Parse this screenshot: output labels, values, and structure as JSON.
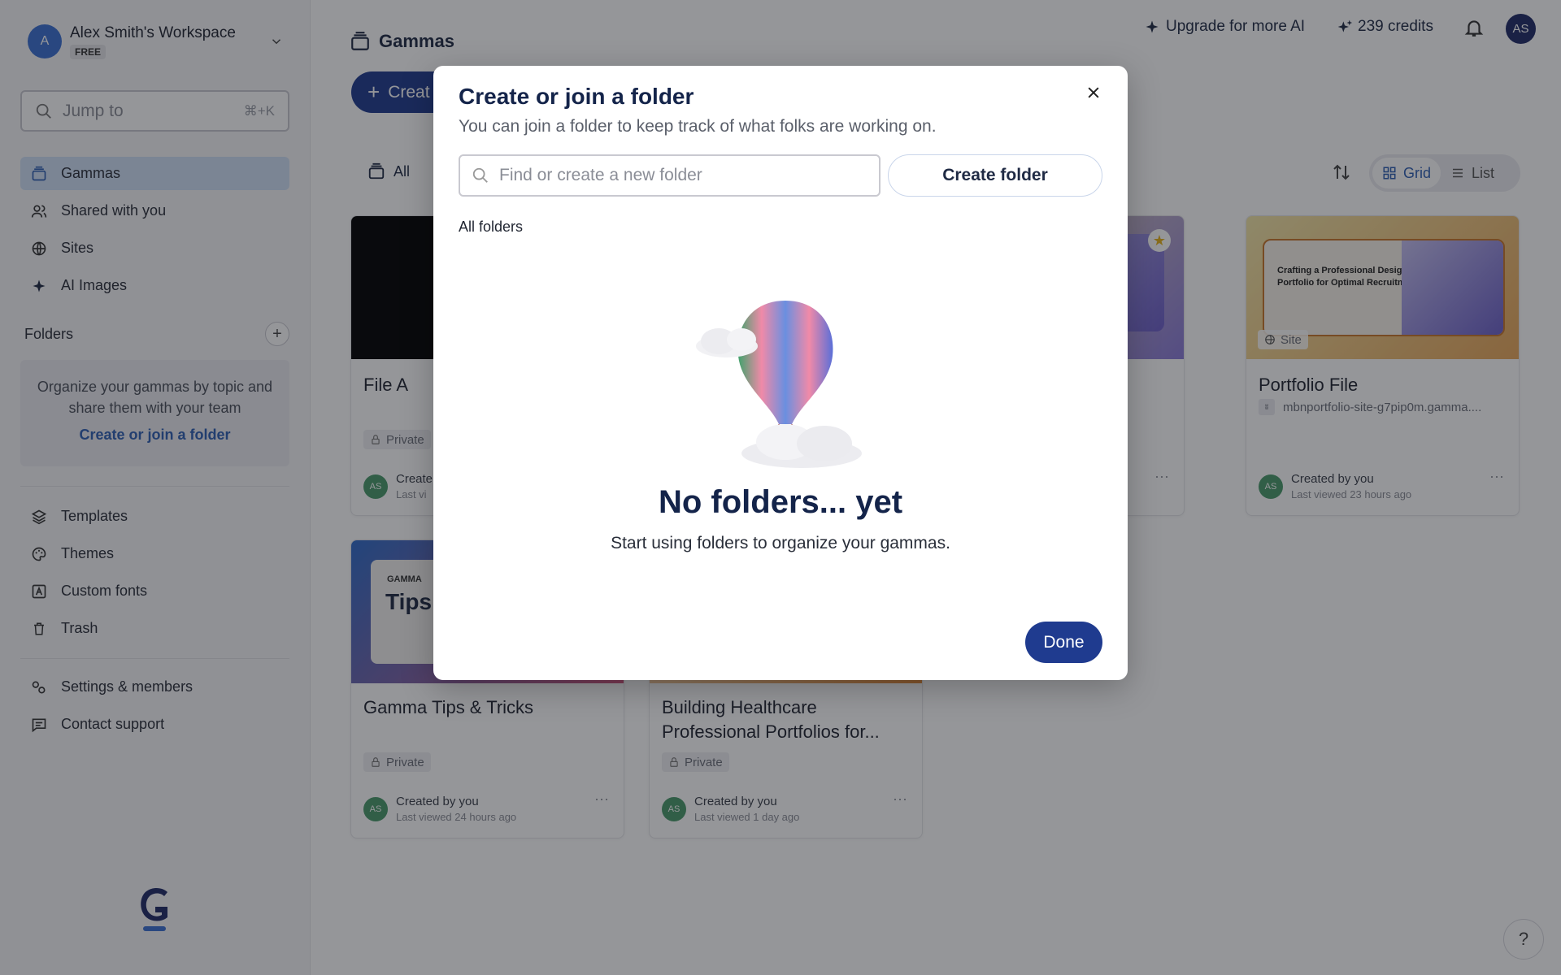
{
  "colors": {
    "accent": "#1f3b8f",
    "link": "#2f5fb3",
    "active_nav": "#cfe0f6",
    "overlay": "rgba(20,22,28,0.45)"
  },
  "workspace": {
    "avatar_letter": "A",
    "name": "Alex Smith's Workspace",
    "plan": "FREE"
  },
  "jump": {
    "placeholder": "Jump to",
    "shortcut": "⌘+K"
  },
  "nav": [
    {
      "label": "Gammas",
      "icon": "stack-icon",
      "active": true
    },
    {
      "label": "Shared with you",
      "icon": "users-icon"
    },
    {
      "label": "Sites",
      "icon": "globe-icon"
    },
    {
      "label": "AI Images",
      "icon": "sparkle-icon"
    }
  ],
  "folders": {
    "heading": "Folders",
    "empty_text": "Organize your gammas by topic and share them with your team",
    "link": "Create or join a folder"
  },
  "nav2": [
    {
      "label": "Templates",
      "icon": "layers-icon"
    },
    {
      "label": "Themes",
      "icon": "palette-icon"
    },
    {
      "label": "Custom fonts",
      "icon": "font-icon"
    },
    {
      "label": "Trash",
      "icon": "trash-icon"
    }
  ],
  "nav3": [
    {
      "label": "Settings & members",
      "icon": "settings-icon"
    },
    {
      "label": "Contact support",
      "icon": "chat-icon"
    }
  ],
  "header": {
    "title": "Gammas",
    "upgrade": "Upgrade for more AI",
    "credits": "239 credits",
    "user_initials": "AS"
  },
  "toolbar": {
    "create_label": "Creat",
    "tab_all": "All",
    "view_grid": "Grid",
    "view_list": "List"
  },
  "cards": [
    {
      "title": "File A",
      "badge": "Private",
      "created": "Create",
      "viewed": "Last vi"
    },
    {
      "title": "Portfolio File",
      "thumb_text": "Crafting a Professional Design Portfolio for Optimal Recruitment",
      "site_badge": "Site",
      "url": "mbnportfolio-site-g7pip0m.gamma....",
      "created": "Created by you",
      "viewed": "Last viewed 23 hours ago",
      "avatar": "AS"
    },
    {
      "title": "Gamma Tips & Tricks",
      "thumb_brand": "GAMMA",
      "thumb_heading": "Tips",
      "badge": "Private",
      "created": "Created by you",
      "viewed": "Last viewed 24 hours ago",
      "avatar": "AS"
    },
    {
      "title": "Building Healthcare Professional Portfolios for...",
      "badge": "Private",
      "created": "Created by you",
      "viewed": "Last viewed 1 day ago",
      "avatar": "AS"
    }
  ],
  "modal": {
    "title": "Create or join a folder",
    "subtitle": "You can join a folder to keep track of what folks are working on.",
    "search_placeholder": "Find or create a new folder",
    "create_button": "Create folder",
    "section_label": "All folders",
    "empty_heading": "No folders... yet",
    "empty_text": "Start using folders to organize your gammas.",
    "done_button": "Done"
  },
  "help": "?"
}
